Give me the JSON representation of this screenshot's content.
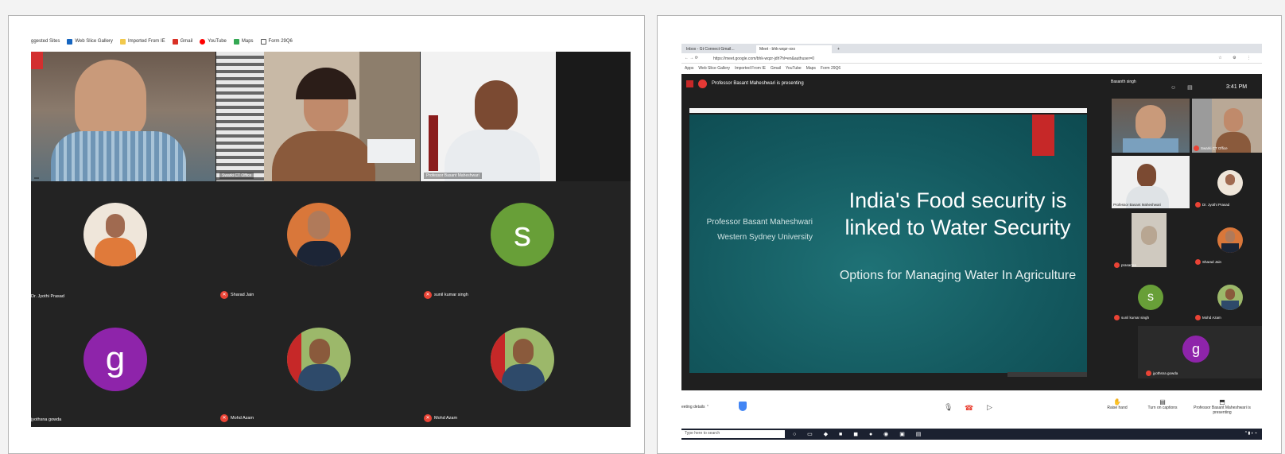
{
  "left": {
    "bookmarks": [
      "ggested Sites",
      "Web Slice Gallery",
      "Imported From IE",
      "Gmail",
      "YouTube",
      "Maps",
      "Form 29Q6"
    ],
    "tiles": [
      "",
      "Swarki CT Office",
      "Professor Basant Maheshwari"
    ],
    "participants": [
      {
        "name": "Dr. Jyothi Prasad",
        "initial": ""
      },
      {
        "name": "Sharad Jain",
        "initial": ""
      },
      {
        "name": "sunil kumar singh",
        "initial": "s"
      },
      {
        "name": "jyothsna gowda",
        "initial": "g"
      },
      {
        "name": "Mohd Azam",
        "initial": ""
      },
      {
        "name": "Mohd Azam",
        "initial": ""
      }
    ],
    "colors": {
      "s_avatar": "#689f38",
      "g_avatar": "#8e24aa",
      "mic": "#ea4335"
    }
  },
  "right": {
    "tabs": [
      "Inbox - Gt Connect Gmail...",
      "Meet - bhk-wqzr-xxx"
    ],
    "url": "https://meet.google.com/bhk-wqzr-jdh?hl=en&authuser=0",
    "bookmarks": [
      "Apps",
      "Web Slice Gallery",
      "Imported From IE",
      "Gmail",
      "YouTube",
      "Maps",
      "Form 29Q6"
    ],
    "presenting_text": "Professor Basant Maheshwari is presenting",
    "time": "3:41 PM",
    "you_label": "Basanth singh",
    "slide": {
      "title": "India's Food security is linked to Water Security",
      "subtitle": "Options for Managing Water In Agriculture",
      "author": "Professor Basant Maheshwari",
      "university": "Western Sydney University"
    },
    "side_participants": [
      {
        "name": "Swarki CT Office",
        "initial": ""
      },
      {
        "name": "Professor Basant Maheshwari",
        "initial": ""
      },
      {
        "name": "Dr. Jyothi Prasad",
        "initial": ""
      },
      {
        "name": "prasanna",
        "initial": ""
      },
      {
        "name": "Sharad Jain",
        "initial": ""
      },
      {
        "name": "sunil kumar singh",
        "initial": "s"
      },
      {
        "name": "Mohd Azam",
        "initial": ""
      },
      {
        "name": "jyothsna gowda",
        "initial": "g"
      }
    ],
    "meeting_details": "eeting details",
    "controls": [
      "Raise hand",
      "Turn on captions",
      "Professor Basant Maheshwari is presenting"
    ],
    "search_placeholder": "Type here to search"
  }
}
